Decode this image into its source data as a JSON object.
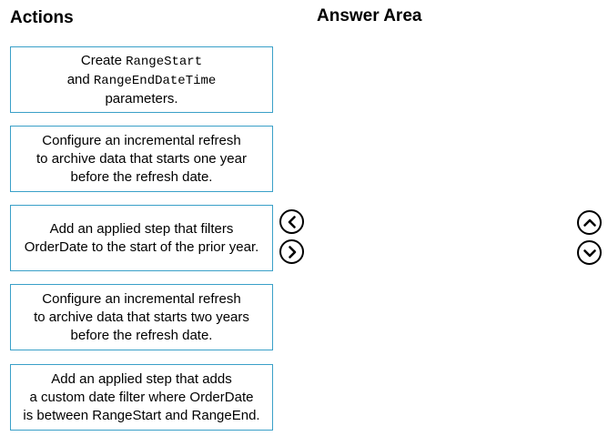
{
  "headings": {
    "actions": "Actions",
    "answer_area": "Answer Area"
  },
  "actions": [
    {
      "line1_pre": "Create ",
      "line1_code": "RangeStart",
      "line2_pre": "and ",
      "line2_code": "RangeEndDateTime",
      "line3": "parameters."
    },
    {
      "text": "Configure an incremental refresh\nto archive data that starts one year\nbefore the refresh date."
    },
    {
      "text": "Add an applied step that filters\nOrderDate to the start of the prior year."
    },
    {
      "text": "Configure an incremental refresh\nto archive data that starts two years\nbefore the refresh date."
    },
    {
      "text": "Add an applied step that adds\na custom date filter where OrderDate\nis between RangeStart and RangeEnd."
    }
  ],
  "controls": {
    "move_left_icon": "chevron-left-icon",
    "move_right_icon": "chevron-right-icon",
    "move_up_icon": "chevron-up-icon",
    "move_down_icon": "chevron-down-icon"
  },
  "colors": {
    "card_border": "#3aa0c8"
  }
}
